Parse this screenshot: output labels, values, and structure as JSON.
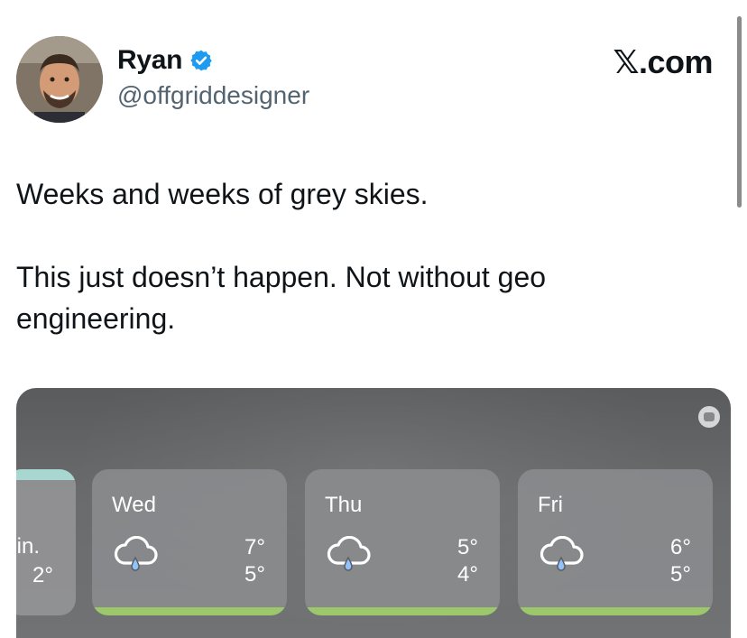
{
  "author": {
    "name": "Ryan",
    "handle": "@offgriddesigner"
  },
  "brand": "𝕏.com",
  "tweet": {
    "line1": "Weeks and weeks of grey skies.",
    "line2": "This just doesn’t happen. Not without geo engineering."
  },
  "forecast": {
    "partial": {
      "label": "ıin.",
      "temp": "2°"
    },
    "days": [
      {
        "day": "Wed",
        "high": "7°",
        "low": "5°",
        "icon": "rain-cloud-icon"
      },
      {
        "day": "Thu",
        "high": "5°",
        "low": "4°",
        "icon": "rain-cloud-icon"
      },
      {
        "day": "Fri",
        "high": "6°",
        "low": "5°",
        "icon": "rain-cloud-icon"
      }
    ]
  },
  "colors": {
    "verified": "#1d9bf0",
    "forecast_bar": "#9cc86b",
    "handle": "#536471"
  }
}
